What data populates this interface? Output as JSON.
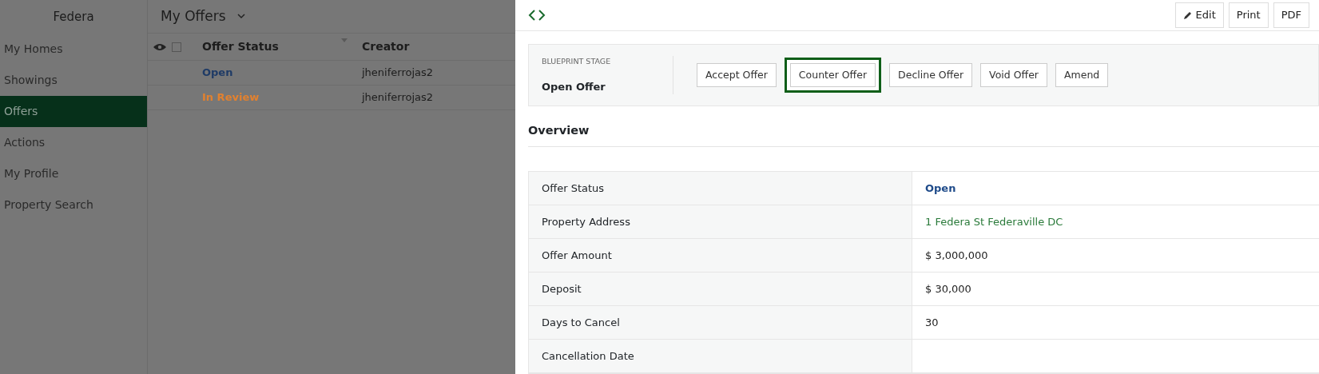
{
  "app": {
    "brand": "Federa",
    "view_title": "My Offers"
  },
  "sidebar": {
    "items": [
      {
        "label": "My Homes",
        "selected": false
      },
      {
        "label": "Showings",
        "selected": false
      },
      {
        "label": "Offers",
        "selected": true
      },
      {
        "label": "Actions",
        "selected": false
      },
      {
        "label": "My Profile",
        "selected": false
      },
      {
        "label": "Property Search",
        "selected": false
      }
    ]
  },
  "table": {
    "select_all": {
      "checked": false
    },
    "columns": [
      "Offer Status",
      "Creator"
    ],
    "rows": [
      {
        "status": "Open",
        "color": "#1f3b66",
        "creator": "jheniferrojas2"
      },
      {
        "status": "In Review",
        "color": "#e2812f",
        "creator": "jheniferrojas2"
      }
    ]
  },
  "detail": {
    "toolbar": [
      "Edit",
      "Print",
      "PDF"
    ],
    "blueprint": {
      "label": "BLUEPRINT STAGE",
      "stage": "Open Offer",
      "actions": [
        {
          "label": "Accept Offer",
          "selected": false
        },
        {
          "label": "Counter Offer",
          "selected": true
        },
        {
          "label": "Decline Offer",
          "selected": false
        },
        {
          "label": "Void Offer",
          "selected": false
        },
        {
          "label": "Amend",
          "selected": false
        }
      ]
    },
    "section_title": "Overview",
    "fields": [
      {
        "label": "Offer Status",
        "value": "Open",
        "kind": "status"
      },
      {
        "label": "Property Address",
        "value": "1 Federa St Federaville DC",
        "kind": "link"
      },
      {
        "label": "Offer Amount",
        "value": "$ 3,000,000",
        "kind": "text"
      },
      {
        "label": "Deposit",
        "value": "$ 30,000",
        "kind": "text"
      },
      {
        "label": "Days to Cancel",
        "value": "30",
        "kind": "text"
      },
      {
        "label": "Cancellation Date"
      }
    ]
  }
}
